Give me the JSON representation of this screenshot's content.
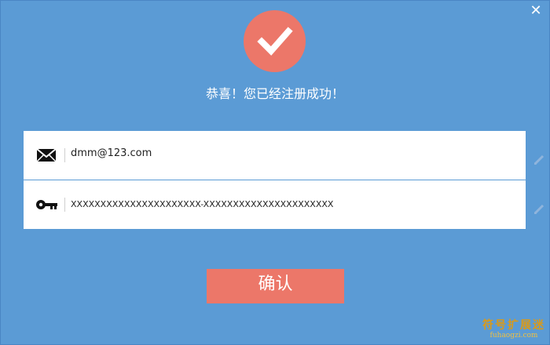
{
  "dialog": {
    "close_label": "✕",
    "title": "恭喜！您已经注册成功！",
    "confirm_label": "确认"
  },
  "fields": {
    "email": {
      "value": "dmm@123.com",
      "icon": "envelope-icon"
    },
    "key": {
      "value": "XXXXXXXXXXXXXXXXXXXXXX-XXXXXXXXXXXXXXXXXXXXXX",
      "icon": "key-icon"
    }
  },
  "watermark": {
    "text_cn": "符号扩展迷",
    "text_en": "fuhaogzi.com"
  },
  "colors": {
    "background": "#5b9bd5",
    "accent": "#ec7769",
    "card": "#ffffff"
  }
}
